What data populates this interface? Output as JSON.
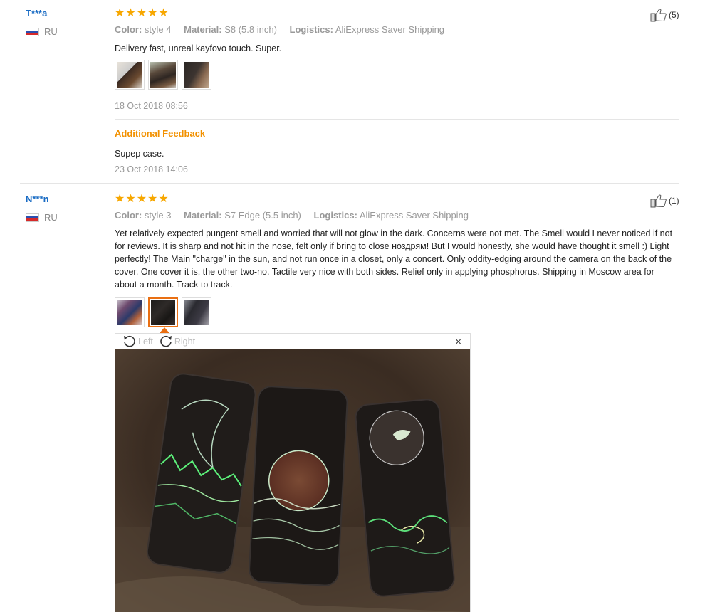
{
  "reviews": [
    {
      "user": "T***a",
      "country": "RU",
      "rating": 5,
      "color_label": "Color:",
      "color_value": "style 4",
      "material_label": "Material:",
      "material_value": "S8 (5.8 inch)",
      "logistics_label": "Logistics:",
      "logistics_value": "AliExpress Saver Shipping",
      "helpful_count": "(5)",
      "text": "Delivery fast, unreal kayfovo touch. Super.",
      "date": "18 Oct 2018 08:56",
      "additional_title": "Additional Feedback",
      "additional_text": "Supep case.",
      "additional_date": "23 Oct 2018 14:06"
    },
    {
      "user": "N***n",
      "country": "RU",
      "rating": 5,
      "color_label": "Color:",
      "color_value": "style 3",
      "material_label": "Material:",
      "material_value": "S7 Edge (5.5 inch)",
      "logistics_label": "Logistics:",
      "logistics_value": "AliExpress Saver Shipping",
      "helpful_count": "(1)",
      "text": "Yet relatively expected pungent smell and worried that will not glow in the dark. Concerns were not met. The Smell would I never noticed if not for reviews. It is sharp and not hit in the nose, felt only if bring to close ноздрям! But I would honestly, she would have thought it smell :) Light perfectly! The Main \"charge\" in the sun, and not run once in a closet, only a concert. Only oddity-edging around the camera on the back of the cover. One cover it is, the other two-no. Tactile very nice with both sides. Relief only in applying phosphorus. Shipping in Moscow area for about a month. Track to track.",
      "viewer": {
        "left_label": "Left",
        "right_label": "Right",
        "close_label": "×"
      }
    }
  ],
  "colors": {
    "accent": "#f7a700",
    "link": "#1a6cc4",
    "muted": "#999999",
    "active_thumb": "#e96f12"
  }
}
